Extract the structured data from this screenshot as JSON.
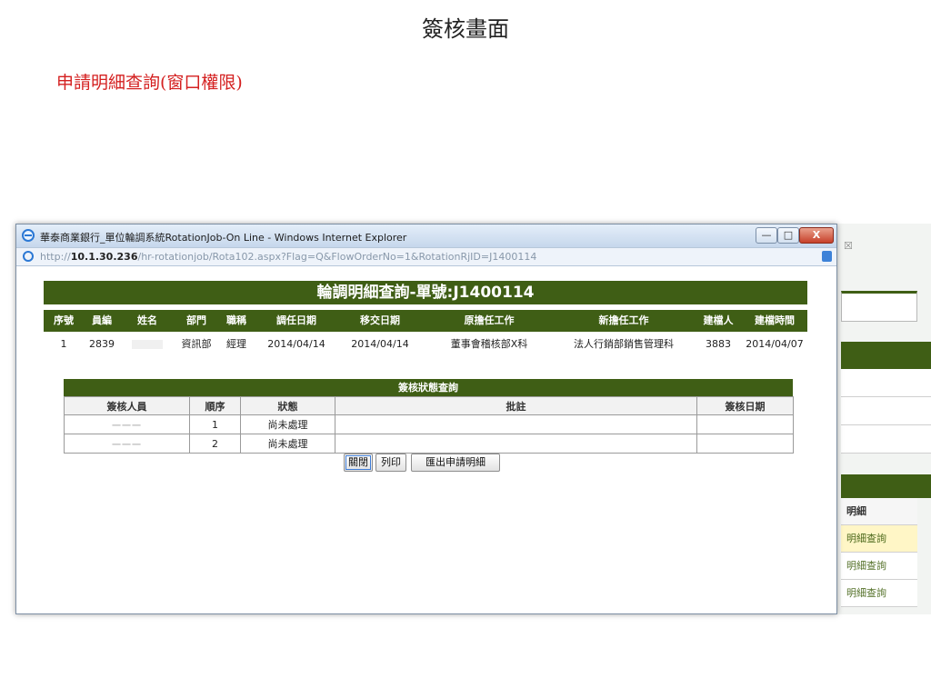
{
  "page": {
    "title": "簽核畫面",
    "subtitle": "申請明細查詢(窗口權限)"
  },
  "window": {
    "title": "華泰商業銀行_單位輪調系統RotationJob-On Line - Windows Internet Explorer",
    "url_prefix": "http://",
    "url_host": "10.1.30.236",
    "url_path": "/hr-rotationjob/Rota102.aspx?Flag=Q&FlowOrderNo=1&RotationRjID=J1400114",
    "btn_min": "—",
    "btn_max": "□",
    "btn_close": "X"
  },
  "detail": {
    "header": "輪調明細查詢-單號:J1400114",
    "columns": [
      "序號",
      "員編",
      "姓名",
      "部門",
      "職稱",
      "調任日期",
      "移交日期",
      "原擔任工作",
      "新擔任工作",
      "建檔人",
      "建檔時間"
    ],
    "row": {
      "seq": "1",
      "emp_id": "2839",
      "dept": "資訊部",
      "position": "經理",
      "transfer_date": "2014/04/14",
      "handover_date": "2014/04/14",
      "old_job": "董事會稽核部X科",
      "new_job": "法人行銷部銷售管理科",
      "creator": "3883",
      "create_time": "2014/04/07"
    }
  },
  "status": {
    "title": "簽核狀態查詢",
    "columns": [
      "簽核人員",
      "順序",
      "狀態",
      "批註",
      "簽核日期"
    ],
    "rows": [
      {
        "signer": "一一一",
        "order": "1",
        "state": "尚未處理"
      },
      {
        "signer": "一一一",
        "order": "2",
        "state": "尚未處理"
      }
    ]
  },
  "buttons": {
    "close": "關閉",
    "print": "列印",
    "export": "匯出申請明細"
  },
  "background": {
    "menu_header": "明細",
    "menu_items": [
      "明細查詢",
      "明細查詢",
      "明細查詢"
    ],
    "close_mark": "☒"
  }
}
